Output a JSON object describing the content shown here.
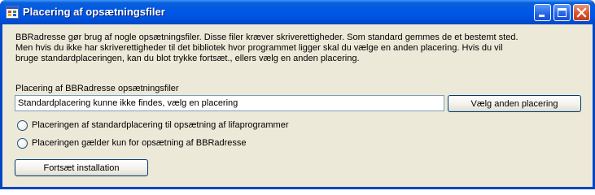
{
  "window": {
    "title": "Placering af opsætningsfiler",
    "controls": {
      "minimize_icon": "minimize-icon",
      "maximize_icon": "maximize-icon",
      "close_icon": "close-icon"
    }
  },
  "description": {
    "lines": [
      "BBRadresse gør brug af nogle opsætningsfiler. Disse filer kræver skriverettigheder. Som standard gemmes de et bestemt sted.",
      "Men hvis du ikke har skriverettigheder til det bibliotek hvor programmet ligger skal du vælge en anden placering. Hvis du vil",
      "bruge standardplaceringen, kan du blot trykke fortsæt., ellers vælg en anden placering."
    ]
  },
  "location": {
    "label": "Placering af BBRadresse opsætningsfiler",
    "value": "Standardplacering kunne ikke findes, vælg en placering",
    "choose_button": "Vælg anden placering"
  },
  "options": [
    {
      "label": "Placeringen af standardplacering til opsætning af lifaprogrammer",
      "selected": false
    },
    {
      "label": "Placeringen gælder kun for opsætning af BBRadresse",
      "selected": false
    }
  ],
  "continue_button": "Fortsæt installation",
  "colors": {
    "titlebar": "#0054e3",
    "client_background": "#ece9d8",
    "close_button": "#d8542c"
  }
}
